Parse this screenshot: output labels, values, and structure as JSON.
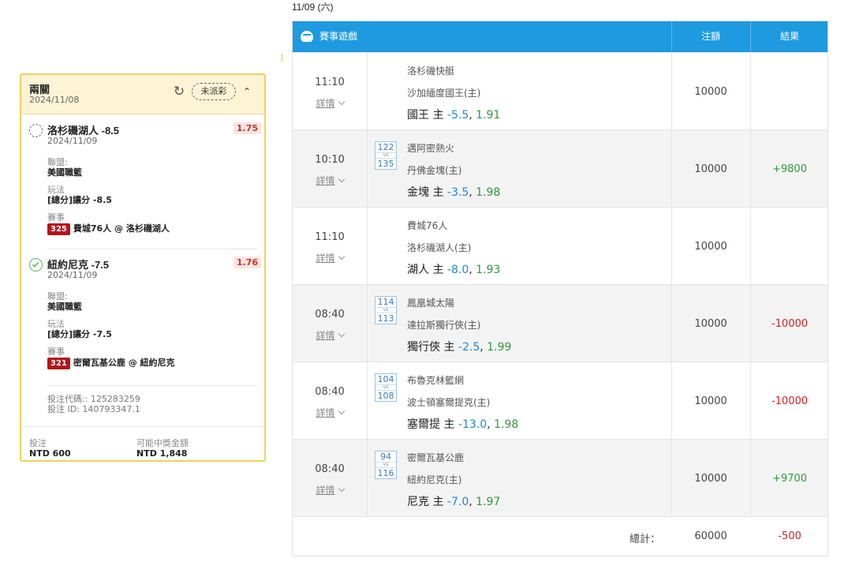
{
  "slip": {
    "title": "兩關",
    "date": "2024/11/08",
    "status_badge": "未派彩",
    "legs": [
      {
        "status": "pending",
        "title": "洛杉磯湖人 -8.5",
        "odds": "1.75",
        "date": "2024/11/09",
        "league_label": "聯盟:",
        "league": "美國職籃",
        "market_label": "玩法",
        "market": "[總分]讓分 -8.5",
        "event_label": "賽事",
        "event_code": "325",
        "event": "費城76人 @ 洛杉磯湖人"
      },
      {
        "status": "won",
        "title": "紐約尼克 -7.5",
        "odds": "1.76",
        "date": "2024/11/09",
        "league_label": "聯盟:",
        "league": "美國職籃",
        "market_label": "玩法",
        "market": "[總分]讓分 -7.5",
        "event_label": "賽事",
        "event_code": "321",
        "event": "密爾瓦基公鹿 @ 紐約尼克"
      }
    ],
    "bet_code": "投注代碼:: 125283259",
    "bet_id": "投注 ID: 140793347.1",
    "stake_label": "投注",
    "stake": "NTD 600",
    "payout_label": "可能中獎金額",
    "payout": "NTD 1,848"
  },
  "results": {
    "date_heading": "11/09 (六)",
    "headers": {
      "game": "賽事遊戲",
      "amount": "注額",
      "result": "結果"
    },
    "detail_label": "詳情",
    "rows": [
      {
        "time": "11:10",
        "away_no": "",
        "home_no": "",
        "away": "洛杉磯快艇",
        "home": "沙加緬度國王(主)",
        "pick_team": "國王 主",
        "pick_line": "-5.5",
        "pick_odds": "1.91",
        "amount": "10000",
        "result": "",
        "result_type": "none"
      },
      {
        "time": "10:10",
        "away_no": "122",
        "home_no": "135",
        "away": "邁阿密熱火",
        "home": "丹佛金塊(主)",
        "pick_team": "金塊 主",
        "pick_line": "-3.5",
        "pick_odds": "1.98",
        "amount": "10000",
        "result": "+9800",
        "result_type": "pos"
      },
      {
        "time": "11:10",
        "away_no": "",
        "home_no": "",
        "away": "費城76人",
        "home": "洛杉磯湖人(主)",
        "pick_team": "湖人 主",
        "pick_line": "-8.0",
        "pick_odds": "1.93",
        "amount": "10000",
        "result": "",
        "result_type": "none"
      },
      {
        "time": "08:40",
        "away_no": "114",
        "home_no": "113",
        "away": "鳳凰城太陽",
        "home": "達拉斯獨行俠(主)",
        "pick_team": "獨行俠 主",
        "pick_line": "-2.5",
        "pick_odds": "1.99",
        "amount": "10000",
        "result": "-10000",
        "result_type": "neg"
      },
      {
        "time": "08:40",
        "away_no": "104",
        "home_no": "108",
        "away": "布魯克林籃網",
        "home": "波士頓塞爾提克(主)",
        "pick_team": "塞爾提 主",
        "pick_line": "-13.0",
        "pick_odds": "1.98",
        "amount": "10000",
        "result": "-10000",
        "result_type": "neg"
      },
      {
        "time": "08:40",
        "away_no": "94",
        "home_no": "116",
        "away": "密爾瓦基公鹿",
        "home": "紐約尼克(主)",
        "pick_team": "尼克 主",
        "pick_line": "-7.0",
        "pick_odds": "1.97",
        "amount": "10000",
        "result": "+9700",
        "result_type": "pos"
      }
    ],
    "total_label": "總計：",
    "total_amount": "60000",
    "total_result": "-500"
  },
  "colors": {
    "header_blue": "#1e9ae0",
    "slip_border": "#f2d25a",
    "positive": "#2e9a3e",
    "negative": "#d42020",
    "line_blue": "#1e88d6",
    "event_code_red": "#b3141b"
  }
}
